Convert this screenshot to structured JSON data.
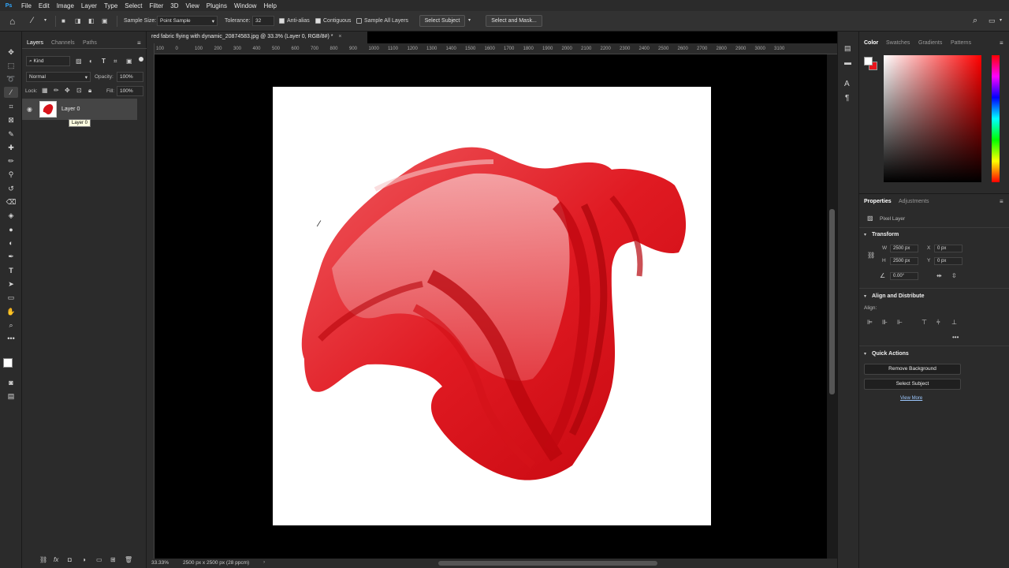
{
  "app": {
    "logo": "Ps"
  },
  "menu": [
    "File",
    "Edit",
    "Image",
    "Layer",
    "Type",
    "Select",
    "Filter",
    "3D",
    "View",
    "Plugins",
    "Window",
    "Help"
  ],
  "options": {
    "sample_size_label": "Sample Size:",
    "sample_size_value": "Point Sample",
    "tolerance_label": "Tolerance:",
    "tolerance_value": "32",
    "anti_alias": "Anti-alias",
    "contiguous": "Contiguous",
    "sample_all_layers": "Sample All Layers",
    "select_subject": "Select Subject",
    "select_and_mask": "Select and Mask..."
  },
  "layers_panel": {
    "tabs": [
      "Layers",
      "Channels",
      "Paths"
    ],
    "filter_kind": "Kind",
    "blend_mode": "Normal",
    "opacity_label": "Opacity:",
    "opacity_value": "100%",
    "lock_label": "Lock:",
    "fill_label": "Fill:",
    "fill_value": "100%",
    "layer_name": "Layer 0",
    "tooltip": "Layer 0"
  },
  "document": {
    "tab_title": "red fabric flying with dynamic_20874583.jpg @ 33.3% (Layer 0, RGB/8#) *",
    "ruler_ticks": [
      "100",
      "0",
      "100",
      "200",
      "300",
      "400",
      "500",
      "600",
      "700",
      "800",
      "900",
      "1000",
      "1100",
      "1200",
      "1300",
      "1400",
      "1500",
      "1600",
      "1700",
      "1800",
      "1900",
      "2000",
      "2100",
      "2200",
      "2300",
      "2400",
      "2500",
      "2600",
      "2700",
      "2800",
      "2900",
      "3000",
      "3100"
    ],
    "zoom": "33.33%",
    "doc_info": "2500 px x 2500 px (28 ppcm)"
  },
  "right_panel": {
    "color_tabs": [
      "Color",
      "Swatches",
      "Gradients",
      "Patterns"
    ],
    "properties_tabs": [
      "Properties",
      "Adjustments"
    ],
    "pixel_layer": "Pixel Layer",
    "transform_title": "Transform",
    "w_label": "W",
    "w_value": "2500 px",
    "h_label": "H",
    "h_value": "2500 px",
    "x_label": "X",
    "x_value": "0 px",
    "y_label": "Y",
    "y_value": "0 px",
    "angle_value": "0.00°",
    "align_title": "Align and Distribute",
    "align_label": "Align:",
    "quick_actions_title": "Quick Actions",
    "remove_background": "Remove Background",
    "select_subject": "Select Subject",
    "view_more": "View More"
  },
  "colors": {
    "accent": "#31a8ff",
    "foreground": "#ffffff",
    "background": "#e8141c",
    "fabric": "#e3141b"
  }
}
